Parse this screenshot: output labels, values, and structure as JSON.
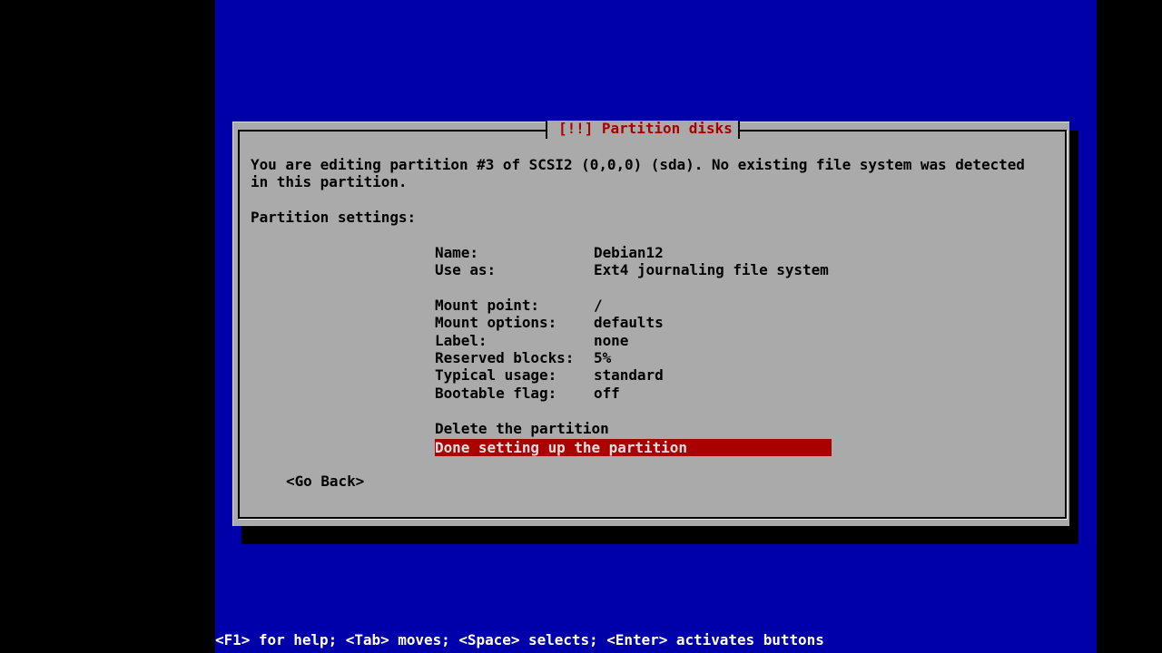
{
  "dialog": {
    "title": "[!!] Partition disks",
    "intro_line1": "You are editing partition #3 of SCSI2 (0,0,0) (sda). No existing file system was detected",
    "intro_line2": "in this partition.",
    "section_heading": "Partition settings:"
  },
  "settings": [
    {
      "label": "Name:",
      "value": "Debian12"
    },
    {
      "label": "Use as:",
      "value": "Ext4 journaling file system"
    },
    {
      "label": "Mount point:",
      "value": "/"
    },
    {
      "label": "Mount options:",
      "value": "defaults"
    },
    {
      "label": "Label:",
      "value": "none"
    },
    {
      "label": "Reserved blocks:",
      "value": "5%"
    },
    {
      "label": "Typical usage:",
      "value": "standard"
    },
    {
      "label": "Bootable flag:",
      "value": "off"
    }
  ],
  "actions": [
    {
      "label": "Delete the partition",
      "selected": false
    },
    {
      "label": "Done setting up the partition",
      "selected": true
    }
  ],
  "buttons": {
    "go_back": "<Go Back>"
  },
  "statusbar": {
    "help_text": "<F1> for help; <Tab> moves; <Space> selects; <Enter> activates buttons"
  },
  "colors": {
    "background": "#0000aa",
    "dialog": "#aaaaaa",
    "title_text": "#aa0000",
    "selection": "#aa0000"
  }
}
